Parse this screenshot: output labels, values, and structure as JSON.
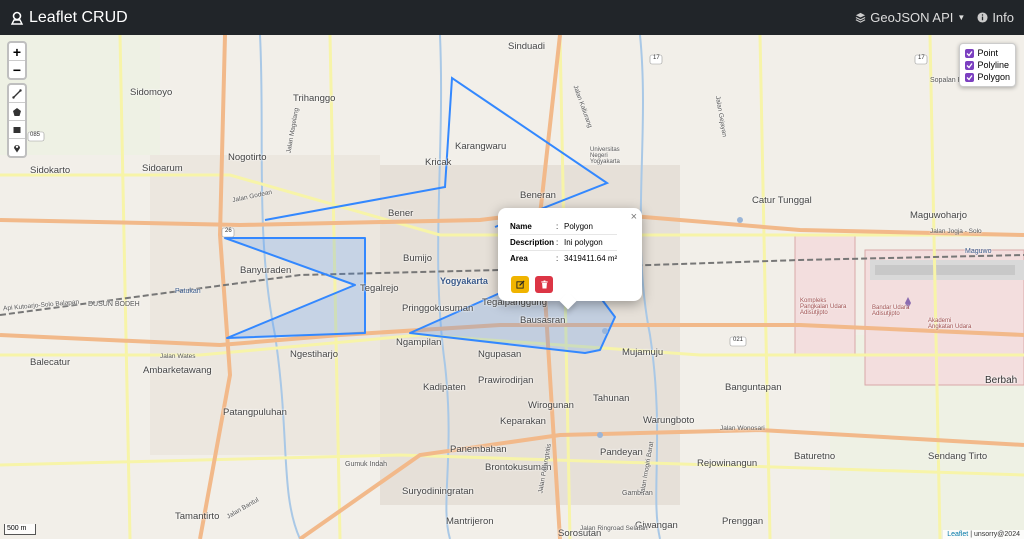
{
  "navbar": {
    "brand": "Leaflet CRUD",
    "geojson_api": "GeoJSON API",
    "info": "Info"
  },
  "controls": {
    "zoom_in": "+",
    "zoom_out": "−"
  },
  "layers": [
    {
      "label": "Point",
      "checked": true
    },
    {
      "label": "Polyline",
      "checked": true
    },
    {
      "label": "Polygon",
      "checked": true
    }
  ],
  "popup": {
    "rows": [
      {
        "key": "Name",
        "value": "Polygon"
      },
      {
        "key": "Description",
        "value": "Ini polygon"
      },
      {
        "key": "Area",
        "value": "3419411.64 m²"
      }
    ],
    "colon": ":",
    "close": "×"
  },
  "map_labels": [
    "Sinduadi",
    "Sidomoyo",
    "Trihanggo",
    "Karangwaru",
    "Nogotirto",
    "Kricak",
    "Sidoarum",
    "Sidokarto",
    "Beneran",
    "Catur Tunggal",
    "Maguwoharjo",
    "Banyuraden",
    "Tegalrejo",
    "Bumijo",
    "Yogyakarta",
    "Tegalpanggung",
    "Bausasran",
    "Mujamuju",
    "Patukan",
    "DUSUN BODEH",
    "Pringgokusuman",
    "Bener",
    "Ngampilan",
    "Ngupasan",
    "Ngestiharjo",
    "Balecatur",
    "Ambarketawang",
    "Kadipaten",
    "Prawirodirjan",
    "Banguntapan",
    "Berbah",
    "Wirogunan",
    "Tahunan",
    "Warungboto",
    "Patangpuluhan",
    "Keparakan",
    "Panembahan",
    "Pandeyan",
    "Rejowinangun",
    "Baturetno",
    "Sendang Tirto",
    "Gumuk Indah",
    "Brontokusuman",
    "Suryodiningratan",
    "Gambiran",
    "Tamantirto",
    "Mantrijeron",
    "Sorosutan",
    "Giwangan",
    "Prenggan",
    "Kompleks Pangkalan Udara Adisutjipto",
    "Akademi Angkatan Udara",
    "Bandar Udara Adisutjipto",
    "Universitas Negeri Yogyakarta",
    "Sopalan Residence",
    "Maguwo"
  ],
  "road_labels": [
    "Jalan Jogja - Solo",
    "Jalan Wates",
    "Jalan Godean",
    "Api Kutoarjo-Solo Balapan",
    "Jalan Kaliurang",
    "Jalan Magelang",
    "Jalan Wonosari",
    "Jalan Imogiri Barat",
    "Jalan Parangtritis",
    "Jalan Bantul",
    "Jalan Ringroad Selatan",
    "Jalan Gejayan"
  ],
  "road_badges": [
    "085",
    "26",
    "17",
    "17",
    "021"
  ],
  "scale": "500 m",
  "attribution": {
    "leaflet": "Leaflet",
    "sep": " | ",
    "author": "unsorry@2024"
  },
  "colors": {
    "navbar": "#212529",
    "polygon_stroke": "#3388ff",
    "edit_button": "#f0b400",
    "delete_button": "#dc3545",
    "layer_checkbox": "#7b3fc0"
  }
}
